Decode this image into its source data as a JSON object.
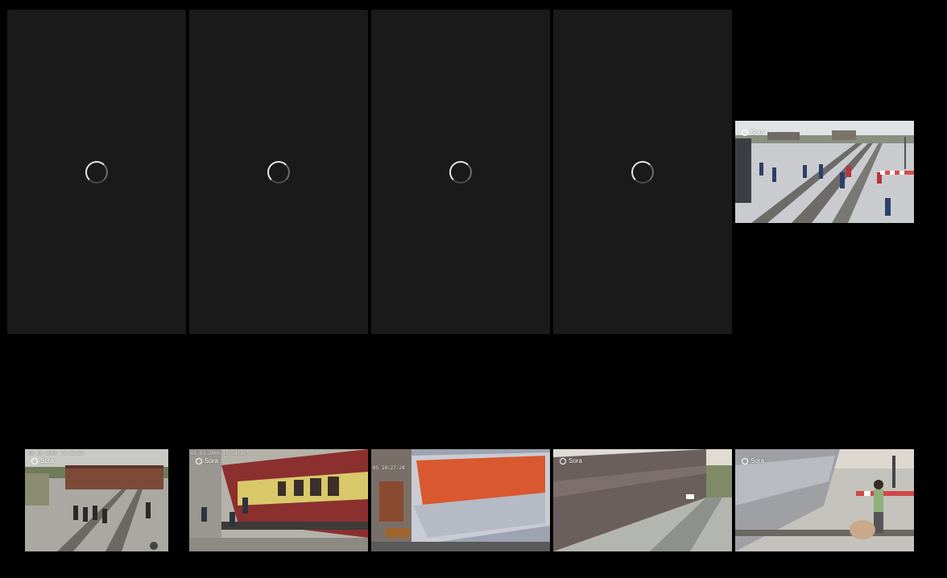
{
  "gallery": {
    "loading_tiles": [
      {
        "icon": "spinner-icon"
      },
      {
        "icon": "spinner-icon"
      },
      {
        "icon": "spinner-icon"
      },
      {
        "icon": "spinner-icon"
      }
    ],
    "video_tiles": [
      {
        "badge": "Sora",
        "stamp": ""
      },
      {
        "badge": "Sora",
        "stamp": "05-10-2006 12:22:25"
      },
      {
        "badge": "Sora",
        "stamp": "05-03-2006 16:34:15"
      },
      {
        "badge": "",
        "stamp": "05 10:27:28"
      },
      {
        "badge": "Sora",
        "stamp": ""
      },
      {
        "badge": "Sora",
        "stamp": ""
      }
    ]
  }
}
